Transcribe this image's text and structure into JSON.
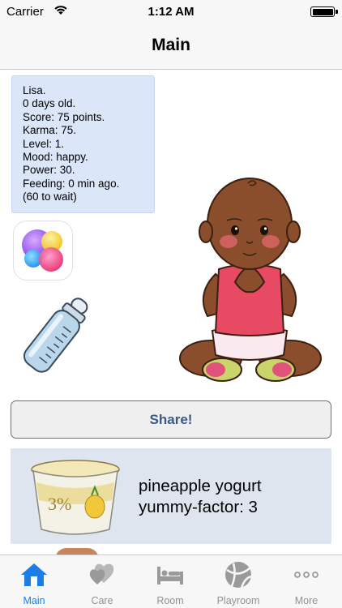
{
  "status_bar": {
    "carrier": "Carrier",
    "time": "1:12 AM"
  },
  "nav": {
    "title": "Main"
  },
  "info": {
    "lines": [
      "Lisa.",
      "0 days old.",
      "Score: 75 points.",
      "Karma: 75.",
      "Level: 1.",
      "Mood: happy.",
      "Power: 30.",
      "Feeding: 0 min ago.",
      "(60 to wait)"
    ]
  },
  "share": {
    "label": "Share!"
  },
  "food": {
    "name": "pineapple yogurt",
    "yummy": "yummy-factor: 3",
    "percent_label": "3%"
  },
  "tabs": [
    {
      "label": "Main",
      "icon": "house-icon",
      "active": true
    },
    {
      "label": "Care",
      "icon": "hearts-icon",
      "active": false
    },
    {
      "label": "Room",
      "icon": "bed-icon",
      "active": false
    },
    {
      "label": "Playroom",
      "icon": "ball-icon",
      "active": false
    },
    {
      "label": "More",
      "icon": "more-dots-icon",
      "active": false
    }
  ],
  "colors": {
    "accent": "#1a7ee6",
    "tab_inactive": "#929292",
    "share_text": "#3a5a86",
    "info_bg": "#dbe6f8",
    "food_bg": "#dfe5ef"
  }
}
